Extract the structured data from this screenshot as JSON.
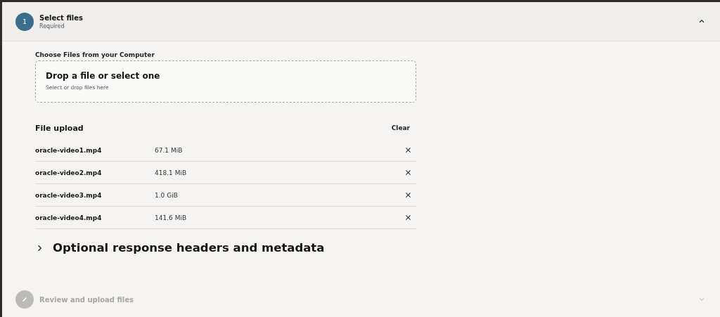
{
  "steps": [
    {
      "number": "1",
      "title": "Select files",
      "subtitle": "Required",
      "expanded": true,
      "disabled": false
    },
    {
      "title": "Review and upload files",
      "expanded": false,
      "disabled": true
    }
  ],
  "file_chooser": {
    "label": "Choose Files from your Computer",
    "title": "Drop a file or select one",
    "hint": "Select or drop files here"
  },
  "file_upload": {
    "title": "File upload",
    "clear": "Clear",
    "files": [
      {
        "name": "oracle-video1.mp4",
        "size": "67.1 MiB"
      },
      {
        "name": "oracle-video2.mp4",
        "size": "418.1 MiB"
      },
      {
        "name": "oracle-video3.mp4",
        "size": "1.0 GiB"
      },
      {
        "name": "oracle-video4.mp4",
        "size": "141.6 MiB"
      }
    ]
  },
  "optional_section": {
    "title": "Optional response headers and metadata",
    "expanded": false
  }
}
